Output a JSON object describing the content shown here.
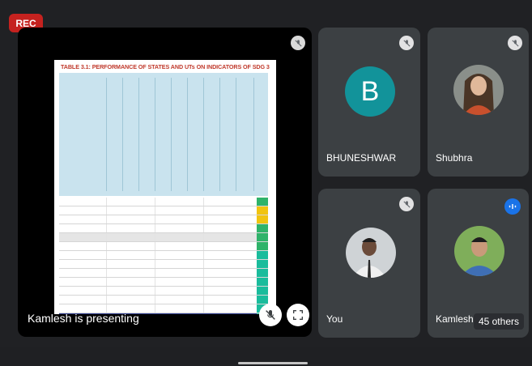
{
  "recording": {
    "label": "REC"
  },
  "presentation": {
    "presenter_label": "Kamlesh is presenting",
    "slide_title": "TABLE 3.1: PERFORMANCE OF STATES AND UTs ON INDICATORS OF SDG 3",
    "icons": [
      "mic-off-icon",
      "fullscreen-icon"
    ]
  },
  "participants": [
    {
      "name": "BHUNESHWAR",
      "avatar_letter": "B",
      "avatar_color": "#12939a",
      "muted": true
    },
    {
      "name": "Shubhra",
      "avatar": "photo",
      "muted": true
    },
    {
      "name": "You",
      "avatar": "photo",
      "muted": true
    },
    {
      "name": "Kamlesh",
      "avatar": "photo",
      "speaking": true,
      "others_label": "45 others"
    }
  ],
  "colors": {
    "background": "#202124",
    "tile": "#3c4043",
    "rec": "#c5221f",
    "speaking": "#1a73e8"
  }
}
